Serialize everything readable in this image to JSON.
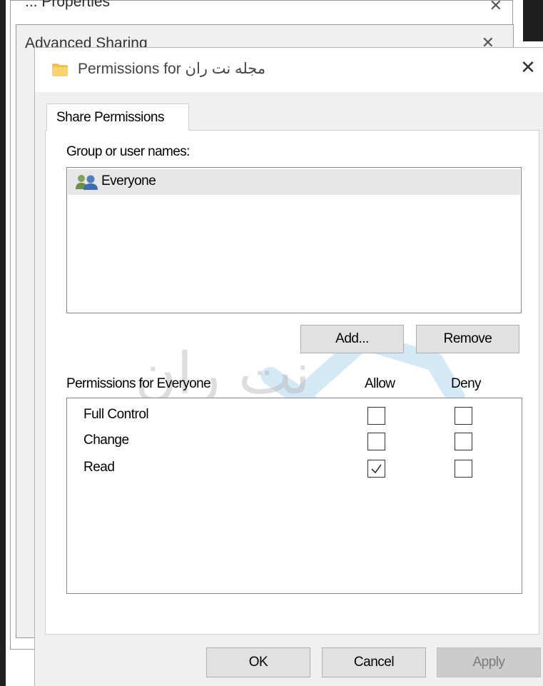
{
  "background": {
    "back_window_title": "... Properties",
    "mid_window_title": "Advanced Sharing",
    "close_glyph": "✕"
  },
  "dialog": {
    "title_prefix": "Permissions for",
    "title_name": "مجله نت ران",
    "close_glyph": "✕",
    "tabs": [
      {
        "label": "Share Permissions",
        "selected": true
      }
    ],
    "group_label": "Group or user names:",
    "users": [
      {
        "name": "Everyone",
        "icon": "users-group-icon",
        "selected": true
      }
    ],
    "add_button": "Add...",
    "remove_button": "Remove",
    "permissions_label": "Permissions for Everyone",
    "allow_header": "Allow",
    "deny_header": "Deny",
    "permissions": [
      {
        "name": "Full Control",
        "allow": false,
        "deny": false
      },
      {
        "name": "Change",
        "allow": false,
        "deny": false
      },
      {
        "name": "Read",
        "allow": true,
        "deny": false
      }
    ],
    "ok_button": "OK",
    "cancel_button": "Cancel",
    "apply_button": "Apply",
    "apply_enabled": false
  },
  "watermark": {
    "logo_text": "نت ران"
  },
  "colors": {
    "dialog_bg": "#f0f0f0",
    "folder_yellow": "#f6c343",
    "selection_bg": "#e7e7e7",
    "button_bg": "#e1e1e1",
    "watermark_blue": "#3fa0d8"
  }
}
